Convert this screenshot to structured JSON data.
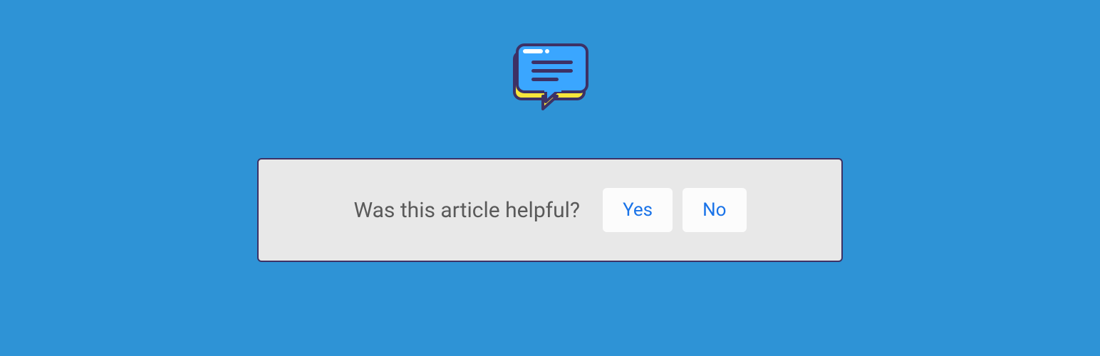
{
  "feedback": {
    "question": "Was this article helpful?",
    "yes_label": "Yes",
    "no_label": "No"
  },
  "colors": {
    "background": "#2e93d6",
    "panel_bg": "#e8e8e8",
    "panel_border": "#3d3165",
    "text": "#5a5a5a",
    "button_bg": "#fcfcfc",
    "button_text": "#1a73e8",
    "icon_bubble": "#3aa6ff",
    "icon_outline": "#3d3165",
    "icon_accent": "#f7e63b"
  }
}
